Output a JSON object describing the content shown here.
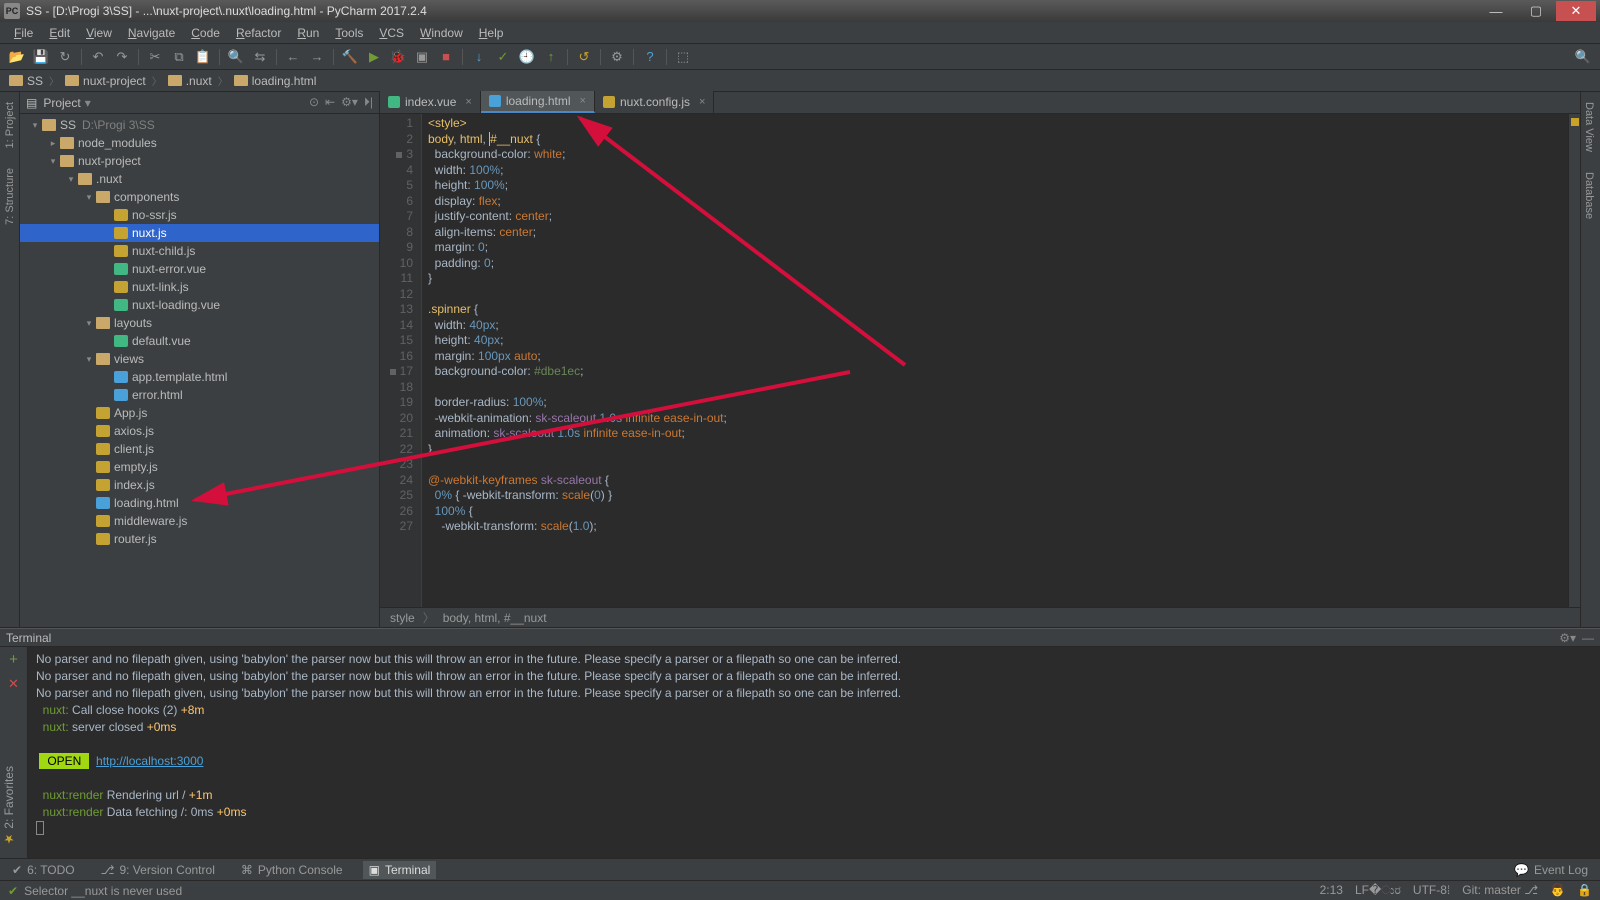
{
  "window": {
    "title": "SS - [D:\\Progi 3\\SS] - ...\\nuxt-project\\.nuxt\\loading.html - PyCharm 2017.2.4"
  },
  "menu": {
    "items": [
      "File",
      "Edit",
      "View",
      "Navigate",
      "Code",
      "Refactor",
      "Run",
      "Tools",
      "VCS",
      "Window",
      "Help"
    ]
  },
  "breadcrumb": {
    "items": [
      "SS",
      "nuxt-project",
      ".nuxt",
      "loading.html"
    ]
  },
  "projectPanel": {
    "title": "Project",
    "tree": [
      {
        "d": 0,
        "exp": "▾",
        "ico": "dir",
        "label": "SS",
        "extra": "D:\\Progi 3\\SS"
      },
      {
        "d": 1,
        "exp": "▸",
        "ico": "dir",
        "label": "node_modules"
      },
      {
        "d": 1,
        "exp": "▾",
        "ico": "dir",
        "label": "nuxt-project"
      },
      {
        "d": 2,
        "exp": "▾",
        "ico": "dir",
        "label": ".nuxt"
      },
      {
        "d": 3,
        "exp": "▾",
        "ico": "dir",
        "label": "components"
      },
      {
        "d": 4,
        "exp": "",
        "ico": "js",
        "label": "no-ssr.js"
      },
      {
        "d": 4,
        "exp": "",
        "ico": "js",
        "label": "nuxt.js",
        "sel": true
      },
      {
        "d": 4,
        "exp": "",
        "ico": "js",
        "label": "nuxt-child.js"
      },
      {
        "d": 4,
        "exp": "",
        "ico": "vue",
        "label": "nuxt-error.vue"
      },
      {
        "d": 4,
        "exp": "",
        "ico": "js",
        "label": "nuxt-link.js"
      },
      {
        "d": 4,
        "exp": "",
        "ico": "vue",
        "label": "nuxt-loading.vue"
      },
      {
        "d": 3,
        "exp": "▾",
        "ico": "dir",
        "label": "layouts"
      },
      {
        "d": 4,
        "exp": "",
        "ico": "vue",
        "label": "default.vue"
      },
      {
        "d": 3,
        "exp": "▾",
        "ico": "dir",
        "label": "views"
      },
      {
        "d": 4,
        "exp": "",
        "ico": "html",
        "label": "app.template.html"
      },
      {
        "d": 4,
        "exp": "",
        "ico": "html",
        "label": "error.html"
      },
      {
        "d": 3,
        "exp": "",
        "ico": "js",
        "label": "App.js"
      },
      {
        "d": 3,
        "exp": "",
        "ico": "js",
        "label": "axios.js"
      },
      {
        "d": 3,
        "exp": "",
        "ico": "js",
        "label": "client.js"
      },
      {
        "d": 3,
        "exp": "",
        "ico": "js",
        "label": "empty.js"
      },
      {
        "d": 3,
        "exp": "",
        "ico": "js",
        "label": "index.js"
      },
      {
        "d": 3,
        "exp": "",
        "ico": "html",
        "label": "loading.html"
      },
      {
        "d": 3,
        "exp": "",
        "ico": "js",
        "label": "middleware.js"
      },
      {
        "d": 3,
        "exp": "",
        "ico": "js",
        "label": "router.js"
      }
    ]
  },
  "leftTabs": [
    "1: Project",
    "7: Structure"
  ],
  "rightTabs": [
    "Data View",
    "Database"
  ],
  "editor": {
    "tabs": [
      {
        "label": "index.vue",
        "ico": "vue"
      },
      {
        "label": "loading.html",
        "ico": "html",
        "active": true
      },
      {
        "label": "nuxt.config.js",
        "ico": "js"
      }
    ],
    "breadcrumb": [
      "style",
      "body, html, #__nuxt"
    ],
    "code": [
      {
        "n": 1,
        "html": "<span class='tag'>&lt;style&gt;</span>"
      },
      {
        "n": 2,
        "html": "<span class='sel'>body</span>, <span class='sel'>html</span>, <span class='caret'></span><span class='sel'>#__nuxt</span> {"
      },
      {
        "n": 3,
        "html": "  background-color: <span class='kw'>white</span>;",
        "mark": true
      },
      {
        "n": 4,
        "html": "  width: <span class='val'>100%</span>;"
      },
      {
        "n": 5,
        "html": "  height: <span class='val'>100%</span>;"
      },
      {
        "n": 6,
        "html": "  display: <span class='kw'>flex</span>;"
      },
      {
        "n": 7,
        "html": "  justify-content: <span class='kw'>center</span>;"
      },
      {
        "n": 8,
        "html": "  align-items: <span class='kw'>center</span>;"
      },
      {
        "n": 9,
        "html": "  margin: <span class='val'>0</span>;"
      },
      {
        "n": 10,
        "html": "  padding: <span class='val'>0</span>;"
      },
      {
        "n": 11,
        "html": "}"
      },
      {
        "n": 12,
        "html": ""
      },
      {
        "n": 13,
        "html": "<span class='sel'>.spinner</span> {"
      },
      {
        "n": 14,
        "html": "  width: <span class='val'>40px</span>;"
      },
      {
        "n": 15,
        "html": "  height: <span class='val'>40px</span>;"
      },
      {
        "n": 16,
        "html": "  margin: <span class='val'>100px</span> <span class='kw'>auto</span>;"
      },
      {
        "n": 17,
        "html": "  background-color: <span class='hex'>#dbe1ec</span>;",
        "mark": true
      },
      {
        "n": 18,
        "html": ""
      },
      {
        "n": 19,
        "html": "  border-radius: <span class='val'>100%</span>;"
      },
      {
        "n": 20,
        "html": "  -webkit-animation: <span class='anim'>sk-scaleout</span> <span class='val'>1.0s</span> <span class='kw'>infinite</span> <span class='kw'>ease-in-out</span>;"
      },
      {
        "n": 21,
        "html": "  animation: <span class='anim'>sk-scaleout</span> <span class='val'>1.0s</span> <span class='kw'>infinite</span> <span class='kw'>ease-in-out</span>;"
      },
      {
        "n": 22,
        "html": "}"
      },
      {
        "n": 23,
        "html": ""
      },
      {
        "n": 24,
        "html": "<span class='kw'>@-webkit-keyframes</span> <span class='anim'>sk-scaleout</span> {"
      },
      {
        "n": 25,
        "html": "  <span class='val'>0%</span> { -webkit-transform: <span class='kw'>scale</span>(<span class='val'>0</span>) }"
      },
      {
        "n": 26,
        "html": "  <span class='val'>100%</span> {"
      },
      {
        "n": 27,
        "html": "    -webkit-transform: <span class='kw'>scale</span>(<span class='val'>1.0</span>);"
      }
    ]
  },
  "terminal": {
    "title": "Terminal",
    "lines": [
      {
        "t": "No parser and no filepath given, using 'babylon' the parser now but this will throw an error in the future. Please specify a parser or a filepath so one can be inferred."
      },
      {
        "t": "No parser and no filepath given, using 'babylon' the parser now but this will throw an error in the future. Please specify a parser or a filepath so one can be inferred."
      },
      {
        "t": "No parser and no filepath given, using 'babylon' the parser now but this will throw an error in the future. Please specify a parser or a filepath so one can be inferred."
      },
      {
        "html": "  <span class='lbl'>nuxt:</span> Call close hooks (2) <span class='time'>+8m</span>"
      },
      {
        "html": "  <span class='lbl'>nuxt:</span> server closed <span class='time'>+0ms</span>"
      },
      {
        "html": ""
      },
      {
        "html": " <span class='open'>OPEN</span>  <span class='url'>http://localhost:3000</span>"
      },
      {
        "html": ""
      },
      {
        "html": "  <span class='lbl'>nuxt:render</span> Rendering url / <span class='time'>+1m</span>"
      },
      {
        "html": "  <span class='lbl'>nuxt:render</span> Data fetching /: 0ms <span class='time'>+0ms</span>"
      },
      {
        "html": "<span class='cur'></span>"
      }
    ]
  },
  "bottomTabs": {
    "items": [
      {
        "label": "6: TODO",
        "ico": "✔"
      },
      {
        "label": "9: Version Control",
        "ico": "⎇"
      },
      {
        "label": "Python Console",
        "ico": "⌘"
      },
      {
        "label": "Terminal",
        "ico": "▣",
        "active": true
      }
    ],
    "eventLog": "Event Log"
  },
  "status": {
    "left": "Selector __nuxt is never used",
    "pos": "2:13",
    "lineEnd": "LF�ುರ",
    "encoding": "UTF-8⁞",
    "git": "Git: master ⎇"
  },
  "leftFavTab": "2: Favorites"
}
